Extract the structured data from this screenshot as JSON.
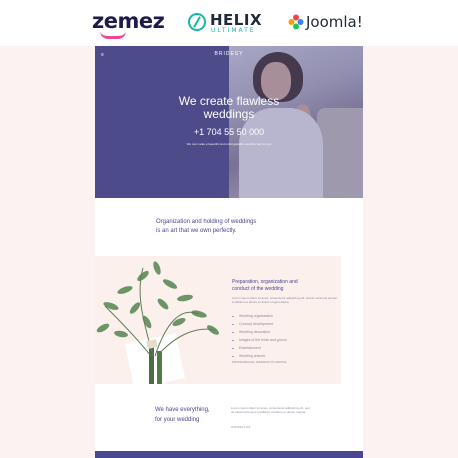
{
  "banner": {
    "zemez_logo": "zemez",
    "helix_logo": "HELIX",
    "helix_sub": "ULTIMATE",
    "joomla_logo": "Joomla!",
    "icons": [
      "zemez-smile-icon",
      "helix-icon",
      "joomla-icon"
    ],
    "colors": {
      "zemez": "#1e1b4b",
      "smile": "#ec4899",
      "helix": "#14b8a6",
      "joomla": [
        "#ef4444",
        "#f59e0b",
        "#22c55e",
        "#3b82f6"
      ]
    }
  },
  "hero": {
    "menu_icon": "menu-icon",
    "brand": "BRIDESY",
    "title_line1": "We create flawless",
    "title_line2": "weddings",
    "phone": "+1 704 55 50 000",
    "note": "We can make a beautiful and unforgettable wedding day for you",
    "color": "#4d4b8a"
  },
  "intro": {
    "line1": "Organization and holding of weddings",
    "line2": "is an art that we own perfectly."
  },
  "services": {
    "heading_line1": "Preparation, organization and",
    "heading_line2": "conduct of the wedding",
    "description": "Lorem ipsum dolor sit amet, consectetur adipiscing elit, sed do eiusmod tempor incididunt ut labore et dolore magna aliqua.",
    "items": [
      "Wedding organization",
      "Concept development",
      "Wedding decoration",
      "Images of the bride and groom",
      "Entertainment",
      "Wedding artwork"
    ],
    "link": "PROFESSIONAL WEDDING PLANNING",
    "card_color": "#fbf0ec"
  },
  "about": {
    "title_line1": "We have everything,",
    "title_line2": "for your wedding",
    "description": "Lorem ipsum dolor sit amet, consectetur adipiscing elit, sed do eiusmod tempor incididunt ut labore et dolore magna.",
    "link": "CONTACT US",
    "accent": "#4a4790"
  }
}
